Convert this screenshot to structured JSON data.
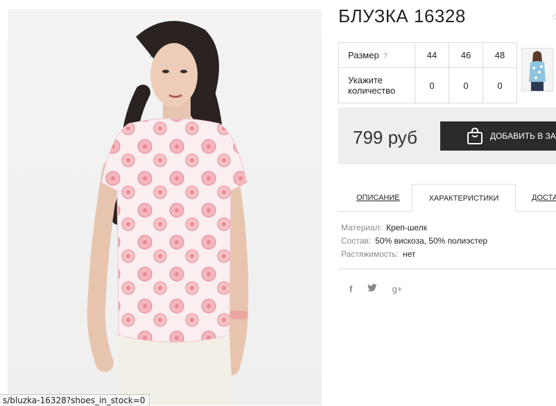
{
  "product": {
    "title": "БЛУЗКА 16328",
    "price": "799 руб",
    "add_to_cart_label": "ДОБАВИТЬ В ЗАК"
  },
  "sizes": {
    "size_label": "Размер",
    "help": "?",
    "qty_label_line1": "Укажите",
    "qty_label_line2": "количество",
    "columns": [
      "44",
      "46",
      "48"
    ],
    "quantities": [
      "0",
      "0",
      "0"
    ]
  },
  "tabs": [
    "ОПИСАНИЕ",
    "ХАРАКТЕРИСТИКИ",
    "ДОСТА"
  ],
  "characteristics": [
    {
      "key": "Материал:",
      "value": "Креп-шелк"
    },
    {
      "key": "Состав:",
      "value": "50% вискоза, 50% полиэстер"
    },
    {
      "key": "Растяжимость:",
      "value": "нет"
    }
  ],
  "social": {
    "facebook": "f",
    "twitter": "twitter-icon",
    "googleplus": "g+"
  },
  "status_url": "s/bluzka-16328?shoes_in_stock=0",
  "colors": {
    "button": "#2b2b2b",
    "pricebox": "#eeeeee",
    "blouse": "#f6c8cc"
  }
}
